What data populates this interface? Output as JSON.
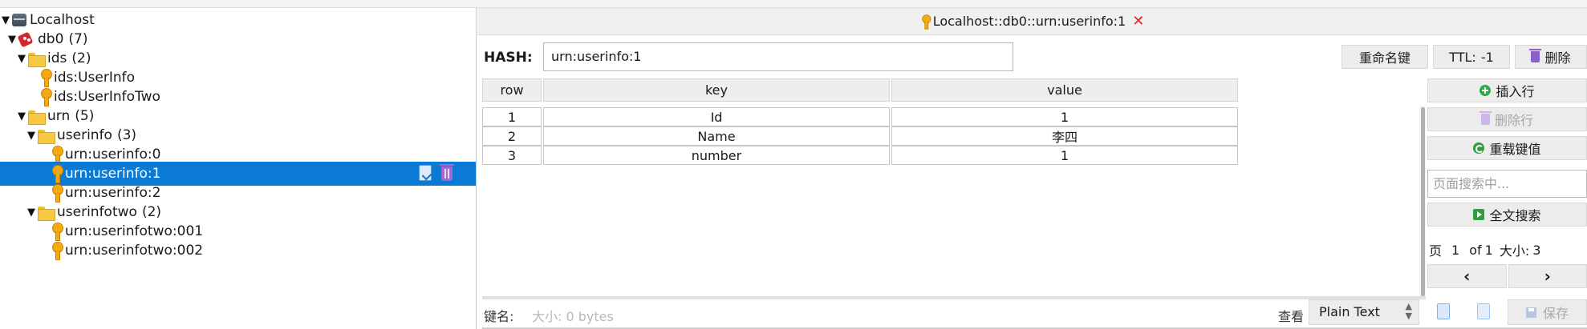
{
  "tree": {
    "nodes": [
      {
        "label": "Localhost",
        "count": "",
        "icon": "server-icon",
        "expanded": true
      },
      {
        "label": "db0",
        "count": "(7)",
        "icon": "database-icon",
        "expanded": true
      },
      {
        "label": "ids",
        "count": "(2)",
        "icon": "folder-icon",
        "expanded": true
      },
      {
        "label": "ids:UserInfo",
        "count": "",
        "icon": "key-icon"
      },
      {
        "label": "ids:UserInfoTwo",
        "count": "",
        "icon": "key-icon"
      },
      {
        "label": "urn",
        "count": "(5)",
        "icon": "folder-icon",
        "expanded": true
      },
      {
        "label": "userinfo",
        "count": "(3)",
        "icon": "folder-icon",
        "expanded": true
      },
      {
        "label": "urn:userinfo:0",
        "count": "",
        "icon": "key-icon"
      },
      {
        "label": "urn:userinfo:1",
        "count": "",
        "icon": "key-icon",
        "selected": true
      },
      {
        "label": "urn:userinfo:2",
        "count": "",
        "icon": "key-icon"
      },
      {
        "label": "userinfotwo",
        "count": "(2)",
        "icon": "folder-icon",
        "expanded": true
      },
      {
        "label": "urn:userinfotwo:001",
        "count": "",
        "icon": "key-icon"
      },
      {
        "label": "urn:userinfotwo:002",
        "count": "",
        "icon": "key-icon"
      }
    ],
    "arrow_expanded": "▼"
  },
  "tab": {
    "title": "Localhost::db0::urn:userinfo:1",
    "close_glyph": "✕"
  },
  "key_header": {
    "type_label": "HASH:",
    "key_value": "urn:userinfo:1",
    "rename_label": "重命名键",
    "ttl_label": "TTL:",
    "ttl_value": "-1",
    "delete_label": "删除"
  },
  "table": {
    "columns": [
      "row",
      "key",
      "value"
    ],
    "rows": [
      {
        "row": "1",
        "key": "Id",
        "value": "1"
      },
      {
        "row": "2",
        "key": "Name",
        "value": "李四"
      },
      {
        "row": "3",
        "key": "number",
        "value": "1"
      }
    ]
  },
  "side": {
    "insert_row": "插入行",
    "delete_row": "删除行",
    "reload_value": "重载键值",
    "search_placeholder": "页面搜索中...",
    "fulltext_search": "全文搜索",
    "page_label": "页",
    "page_current": "1",
    "page_of": "of",
    "page_total": "1",
    "size_label": "大小:",
    "size_value": "3",
    "prev_glyph": "‹",
    "next_glyph": "›"
  },
  "footer": {
    "key_name_label": "键名:",
    "size_text": "大小: 0 bytes",
    "view_label": "查看",
    "view_mode": "Plain Text",
    "save_label": "保存"
  },
  "colors": {
    "selection": "#0a7ad6",
    "delete_accent": "#d9262a",
    "key_icon": "#f3a90f"
  }
}
